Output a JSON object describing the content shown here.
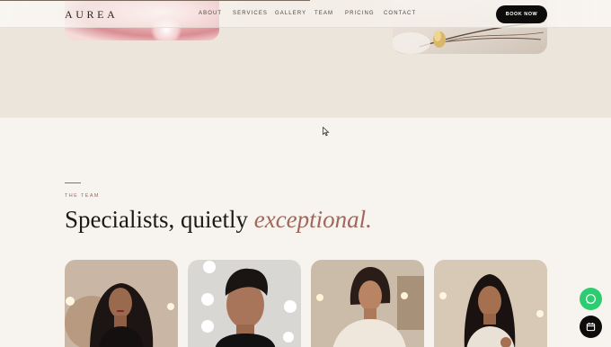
{
  "header": {
    "logo": "AUREA",
    "nav": [
      {
        "label": "ABOUT"
      },
      {
        "label": "SERVICES"
      },
      {
        "label": "GALLERY"
      },
      {
        "label": "TEAM"
      },
      {
        "label": "PRICING"
      },
      {
        "label": "CONTACT"
      }
    ],
    "cta_label": "BOOK NOW"
  },
  "team": {
    "eyebrow": "THE TEAM",
    "title_plain": "Specialists, quietly ",
    "title_accent": "exceptional.",
    "members": [
      {
        "icon": "portrait-photo"
      },
      {
        "icon": "portrait-photo"
      },
      {
        "icon": "portrait-photo"
      },
      {
        "icon": "portrait-photo"
      }
    ]
  },
  "floating": {
    "chat_icon": "whatsapp-icon",
    "calendar_icon": "calendar-icon"
  },
  "colors": {
    "accent": "#a0685b",
    "cta_bg": "#0d0c0b",
    "chat_green": "#2ecc71",
    "band_bg": "#ebe5dc",
    "page_bg": "#f7f3ef"
  }
}
